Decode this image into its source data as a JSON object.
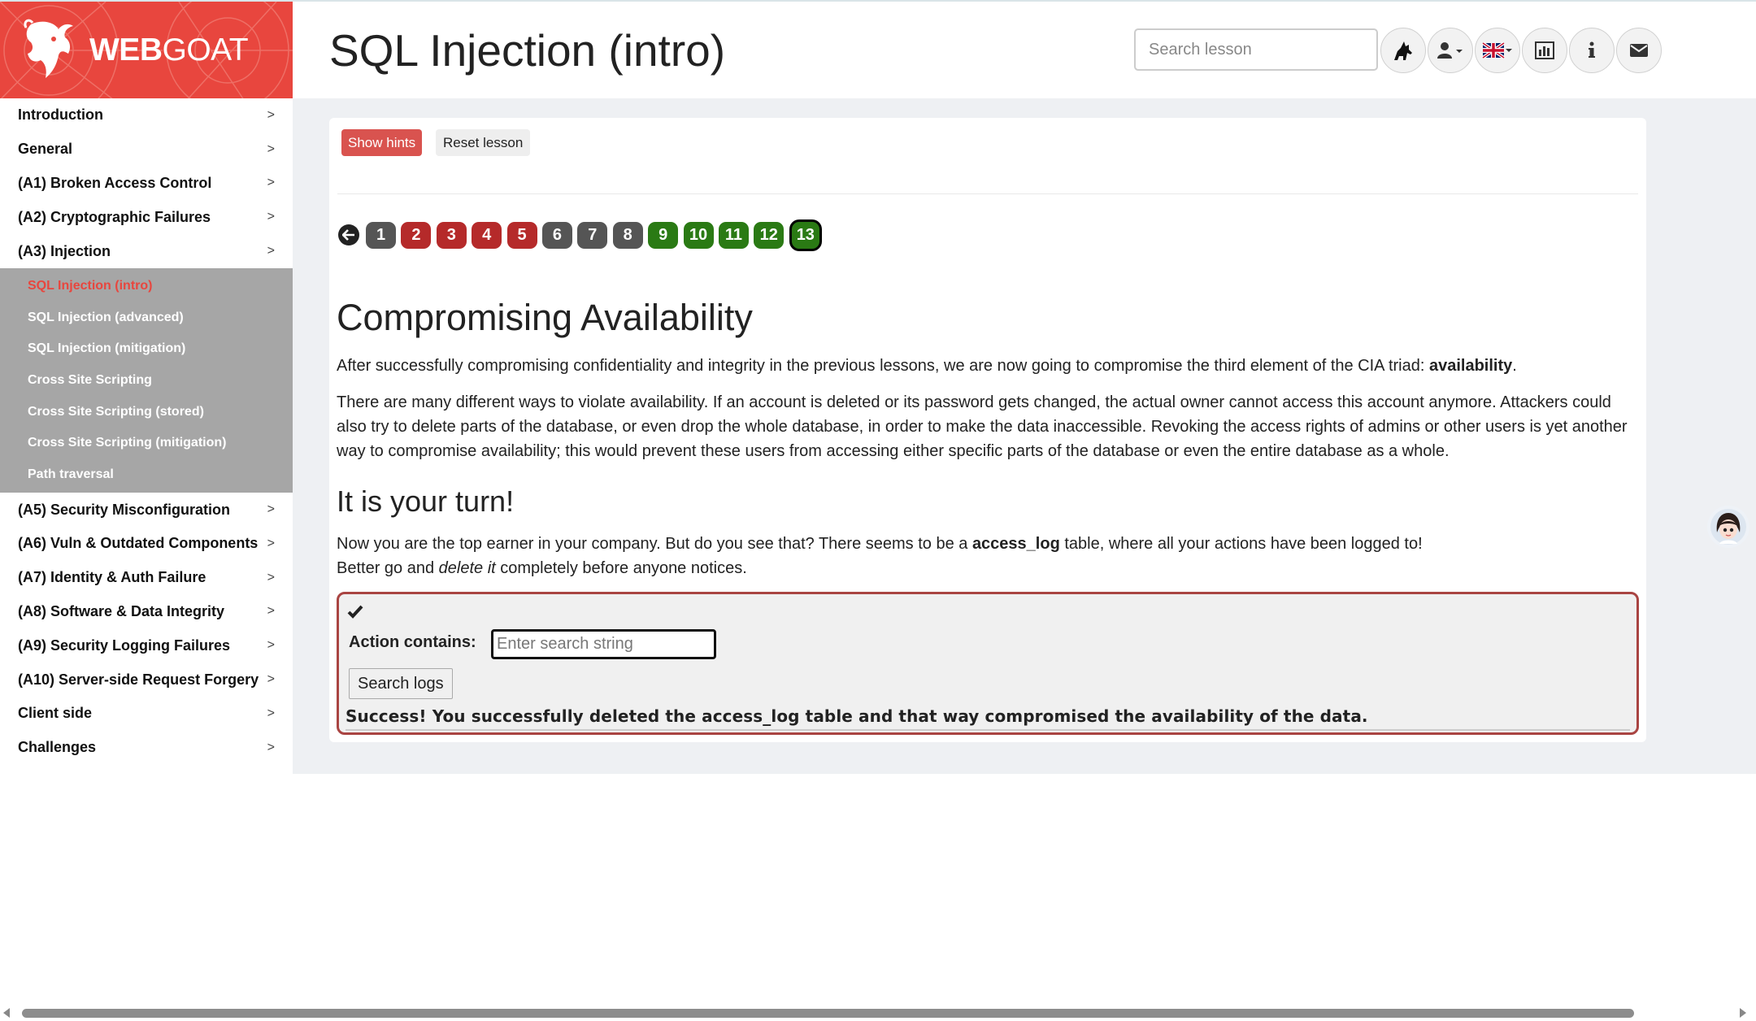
{
  "brand": {
    "name_bold": "WEB",
    "name_rest": "GOAT"
  },
  "page": {
    "title": "SQL Injection (intro)"
  },
  "search": {
    "placeholder": "Search lesson"
  },
  "toolbar": {
    "icons": [
      "wolf-icon",
      "user-menu-icon",
      "uk-flag-language-icon",
      "report-card-icon",
      "about-icon",
      "contact-icon"
    ]
  },
  "sidebar": {
    "categories_top": [
      {
        "label": "Introduction"
      },
      {
        "label": "General"
      },
      {
        "label": "(A1) Broken Access Control"
      },
      {
        "label": "(A2) Cryptographic Failures"
      },
      {
        "label": "(A3) Injection"
      }
    ],
    "injection_lessons": [
      {
        "label": "SQL Injection (intro)",
        "active": true
      },
      {
        "label": "SQL Injection (advanced)"
      },
      {
        "label": "SQL Injection (mitigation)"
      },
      {
        "label": "Cross Site Scripting"
      },
      {
        "label": "Cross Site Scripting (stored)"
      },
      {
        "label": "Cross Site Scripting (mitigation)"
      },
      {
        "label": "Path traversal"
      }
    ],
    "categories_bottom": [
      {
        "label": "(A5) Security Misconfiguration"
      },
      {
        "label": "(A6) Vuln & Outdated Components"
      },
      {
        "label": "(A7) Identity & Auth Failure"
      },
      {
        "label": "(A8) Software & Data Integrity"
      },
      {
        "label": "(A9) Security Logging Failures"
      },
      {
        "label": "(A10) Server-side Request Forgery"
      },
      {
        "label": "Client side"
      },
      {
        "label": "Challenges"
      }
    ],
    "chevron": ">"
  },
  "lesson_buttons": {
    "show_hints": "Show hints",
    "reset": "Reset lesson"
  },
  "pagination": {
    "pages": [
      {
        "label": "1",
        "status": "gray"
      },
      {
        "label": "2",
        "status": "red"
      },
      {
        "label": "3",
        "status": "red"
      },
      {
        "label": "4",
        "status": "red"
      },
      {
        "label": "5",
        "status": "red"
      },
      {
        "label": "6",
        "status": "gray"
      },
      {
        "label": "7",
        "status": "gray"
      },
      {
        "label": "8",
        "status": "gray"
      },
      {
        "label": "9",
        "status": "green"
      },
      {
        "label": "10",
        "status": "green"
      },
      {
        "label": "11",
        "status": "green"
      },
      {
        "label": "12",
        "status": "green"
      },
      {
        "label": "13",
        "status": "current"
      }
    ]
  },
  "content": {
    "heading": "Compromising Availability",
    "p1_text": "After successfully compromising confidentiality and integrity in the previous lessons, we are now going to compromise the third element of the CIA triad: ",
    "p1_bold": "availability",
    "p1_end": ".",
    "p2": "There are many different ways to violate availability. If an account is deleted or its password gets changed, the actual owner cannot access this account anymore. Attackers could also try to delete parts of the database, or even drop the whole database, in order to make the data inaccessible. Revoking the access rights of admins or other users is yet another way to compromise availability; this would prevent these users from accessing either specific parts of the database or even the entire database as a whole.",
    "subheading": "It is your turn!",
    "p3_a": "Now you are the top earner in your company. But do you see that? There seems to be a ",
    "p3_bold": "access_log",
    "p3_b": " table, where all your actions have been logged to!",
    "p4_a": "Better go and ",
    "p4_italic": "delete it",
    "p4_b": " completely before anyone notices."
  },
  "attack": {
    "label": "Action contains:",
    "input_placeholder": "Enter search string",
    "input_value": "",
    "button": "Search logs",
    "feedback": "Success! You successfully deleted the access_log table and that way compromised the availability of the data."
  },
  "colors": {
    "brand_red": "#e8463e",
    "page_red": "#b52a2a",
    "page_gray": "#555555",
    "page_green": "#2a7a14",
    "attack_border": "#a94442",
    "sidebar_sub_bg": "#a6a6a6"
  }
}
